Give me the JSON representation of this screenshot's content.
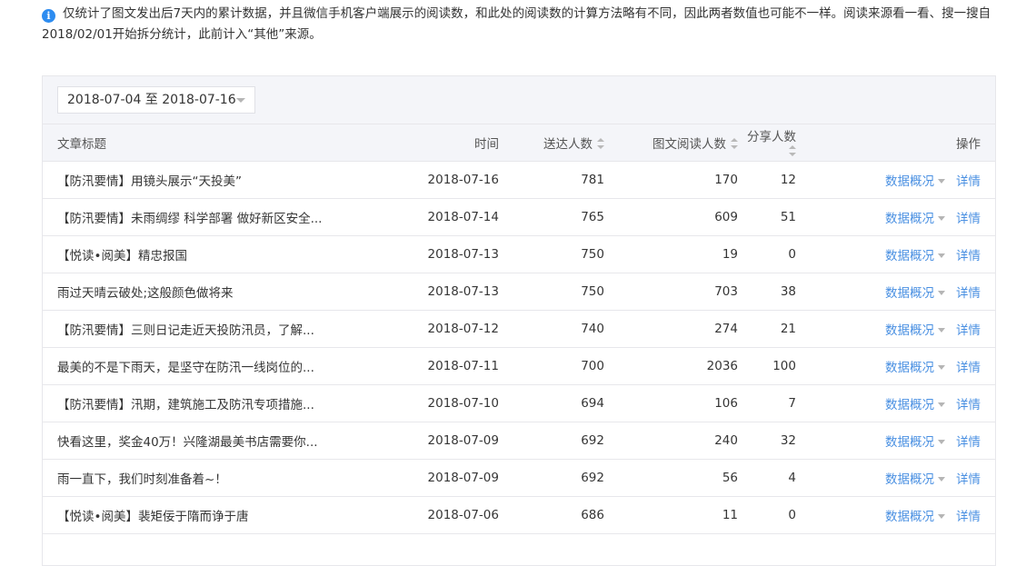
{
  "notice": {
    "text": "仅统计了图文发出后7天内的累计数据，并且微信手机客户端展示的阅读数，和此处的阅读数的计算方法略有不同，因此两者数值也可能不一样。阅读来源看一看、搜一搜自2018/02/01开始拆分统计，此前计入“其他”来源。",
    "icon": "info-icon"
  },
  "filter": {
    "date_range": "2018-07-04 至 2018-07-16"
  },
  "table": {
    "headers": {
      "title": "文章标题",
      "time": "时间",
      "sent": "送达人数",
      "read": "图文阅读人数",
      "share": "分享人数",
      "ops": "操作"
    },
    "op_overview": "数据概况",
    "op_detail": "详情",
    "rows": [
      {
        "title": "【防汛要情】用镜头展示“天投美”",
        "time": "2018-07-16",
        "sent": "781",
        "read": "170",
        "share": "12"
      },
      {
        "title": "【防汛要情】未雨绸缪 科学部署 做好新区安全...",
        "time": "2018-07-14",
        "sent": "765",
        "read": "609",
        "share": "51"
      },
      {
        "title": "【悦读•阅美】精忠报国",
        "time": "2018-07-13",
        "sent": "750",
        "read": "19",
        "share": "0"
      },
      {
        "title": "雨过天晴云破处;这般颜色做将来",
        "time": "2018-07-13",
        "sent": "750",
        "read": "703",
        "share": "38"
      },
      {
        "title": "【防汛要情】三则日记走近天投防汛员，了解...",
        "time": "2018-07-12",
        "sent": "740",
        "read": "274",
        "share": "21"
      },
      {
        "title": "最美的不是下雨天，是坚守在防汛一线岗位的...",
        "time": "2018-07-11",
        "sent": "700",
        "read": "2036",
        "share": "100"
      },
      {
        "title": "【防汛要情】汛期，建筑施工及防汛专项措施...",
        "time": "2018-07-10",
        "sent": "694",
        "read": "106",
        "share": "7"
      },
      {
        "title": "快看这里，奖金40万！兴隆湖最美书店需要你...",
        "time": "2018-07-09",
        "sent": "692",
        "read": "240",
        "share": "32"
      },
      {
        "title": "雨一直下，我们时刻准备着~！",
        "time": "2018-07-09",
        "sent": "692",
        "read": "56",
        "share": "4"
      },
      {
        "title": "【悦读•阅美】裴矩佞于隋而诤于唐",
        "time": "2018-07-06",
        "sent": "686",
        "read": "11",
        "share": "0"
      }
    ]
  }
}
